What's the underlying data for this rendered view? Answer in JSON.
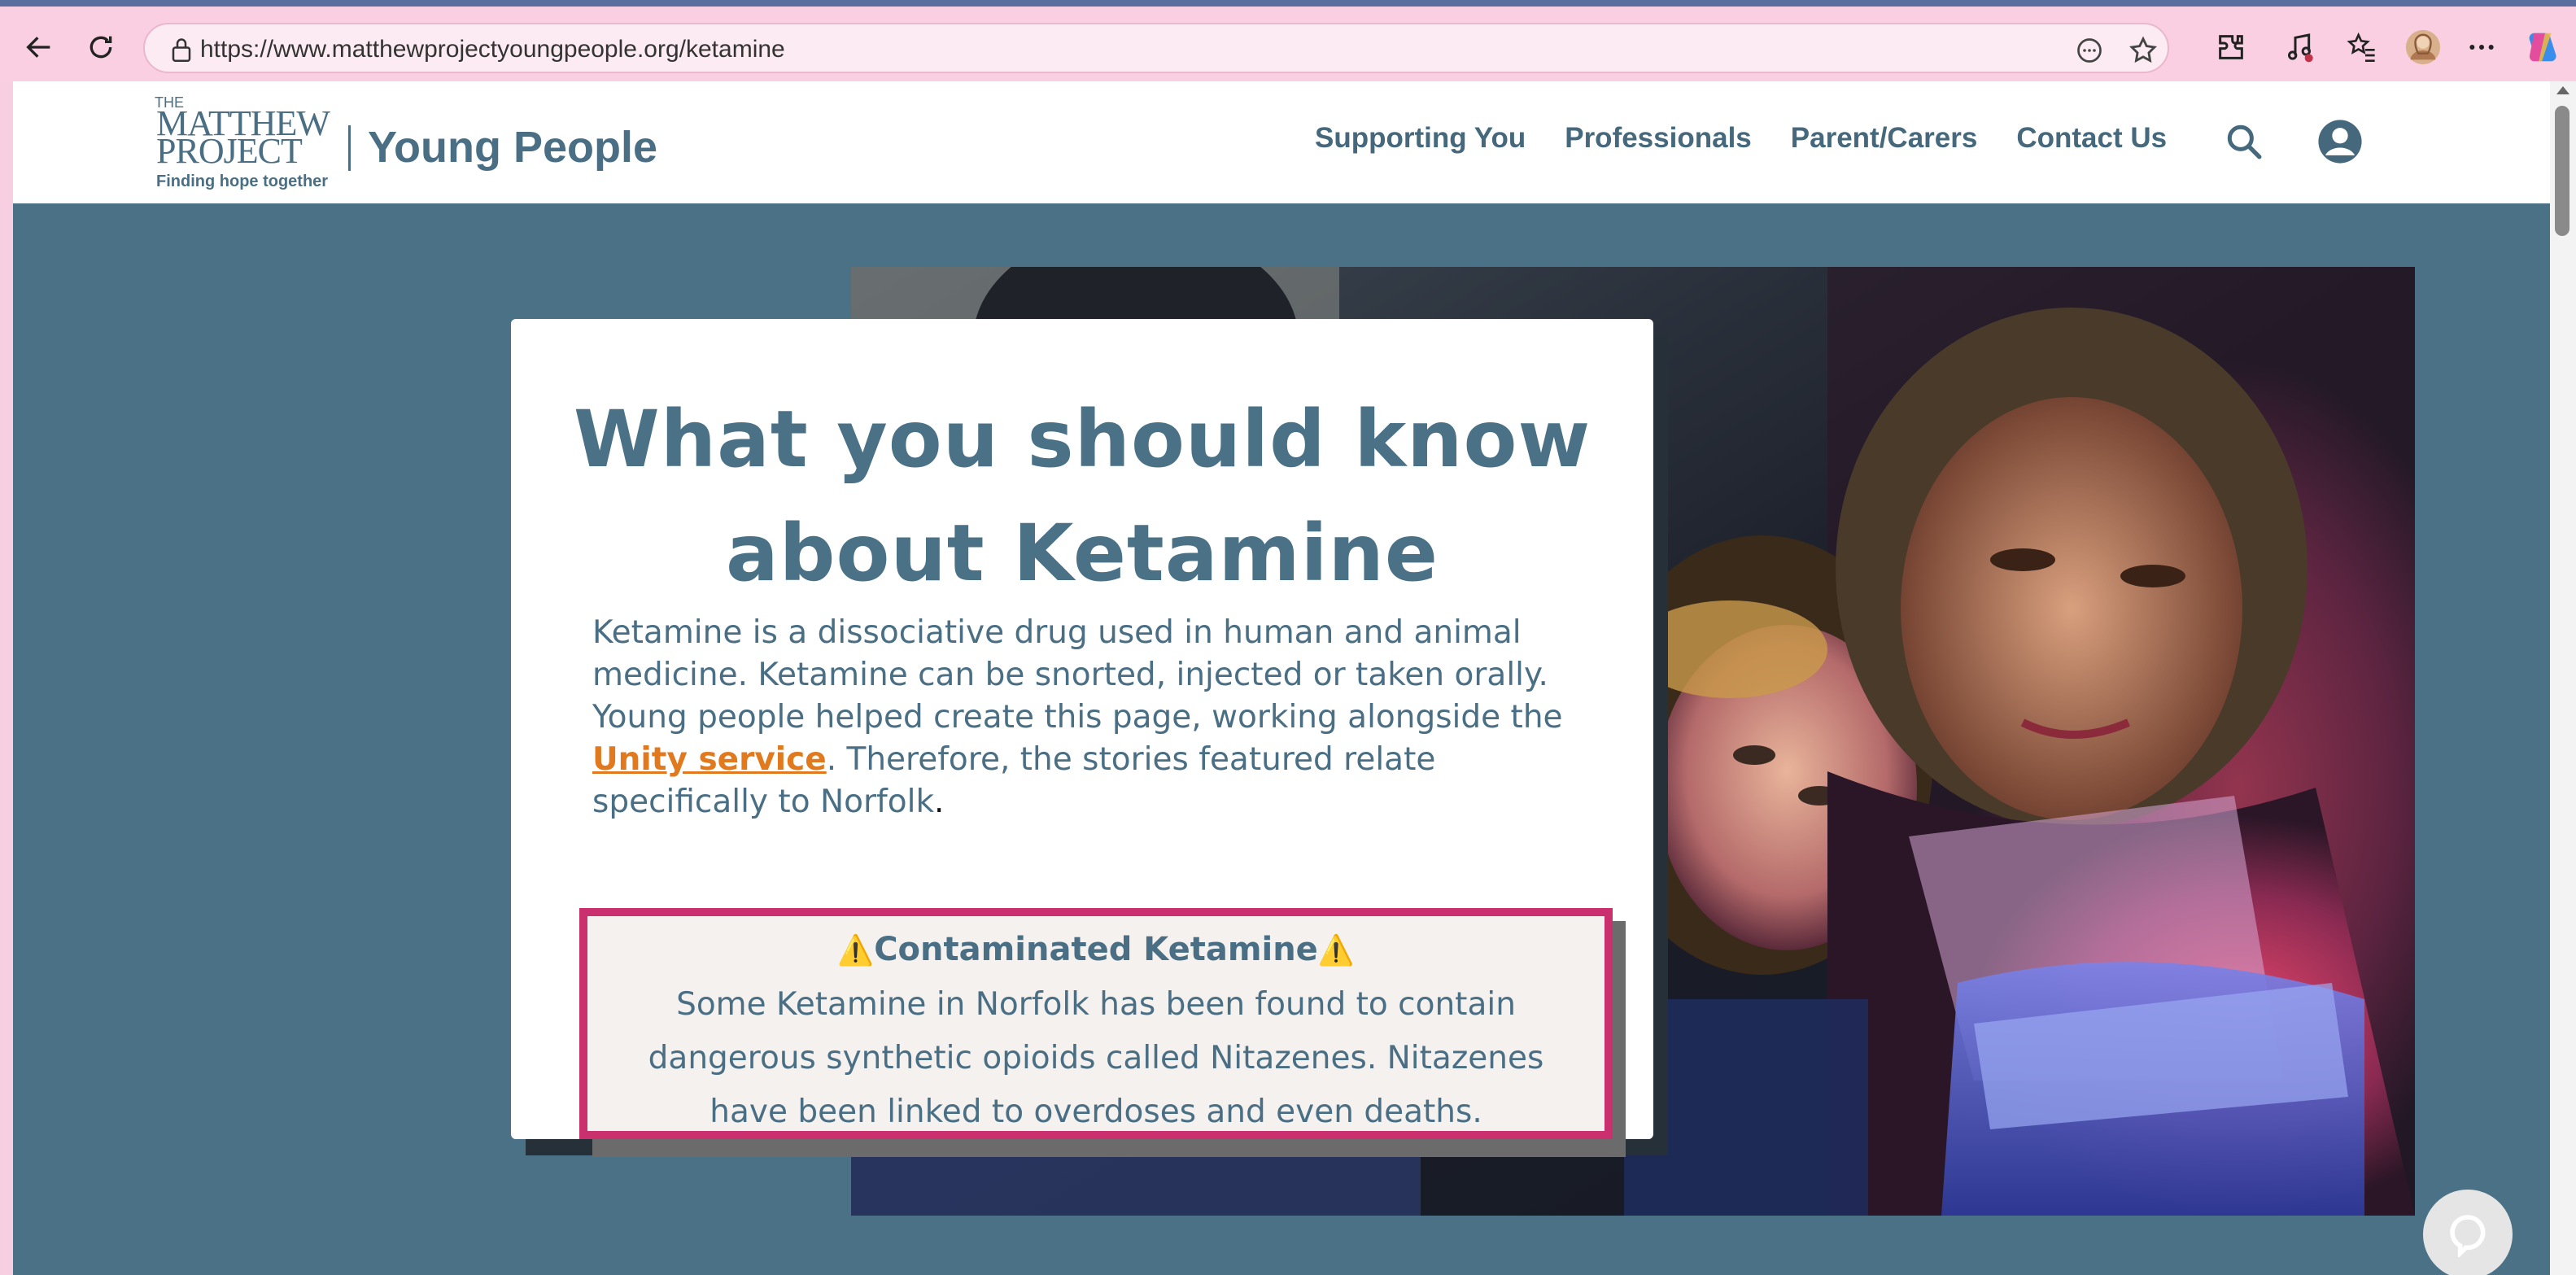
{
  "browser": {
    "url": "https://www.matthewprojectyoungpeople.org/ketamine"
  },
  "header": {
    "logo_the": "THE",
    "logo_matthew": "MATTHEW",
    "logo_project": "PROJECT",
    "logo_tagline": "Finding hope together",
    "site_name": "Young People",
    "nav": [
      "Supporting You",
      "Professionals",
      "Parent/Carers",
      "Contact Us"
    ]
  },
  "hero": {
    "title_line1": "What you should know",
    "title_line2": "about Ketamine",
    "intro_part1": "Ketamine is a dissociative drug used in human and animal medicine. Ketamine can be snorted, injected or taken orally. Young people helped create this page, working alongside the ",
    "intro_link": "Unity service",
    "intro_part2": ". Therefore, the stories featured relate specifically to Norfolk",
    "intro_end": ".",
    "warning_icon": "⚠️",
    "warning_title": "Contaminated Ketamine",
    "warning_body": "Some Ketamine in Norfolk has been found to contain dangerous synthetic opioids called Nitazenes. Nitazenes have been linked to overdoses and even deaths."
  },
  "colors": {
    "page_bg": "#4a7186",
    "brand": "#4a6f84",
    "link": "#e17a1e",
    "warning_border": "#c9306d"
  },
  "icons": [
    "back-icon",
    "refresh-icon",
    "lock-icon",
    "reader-icon",
    "star-icon",
    "extensions-icon",
    "music-icon",
    "favorites-icon",
    "profile-avatar",
    "more-icon",
    "copilot-icon",
    "search-icon",
    "account-icon",
    "chat-icon"
  ]
}
